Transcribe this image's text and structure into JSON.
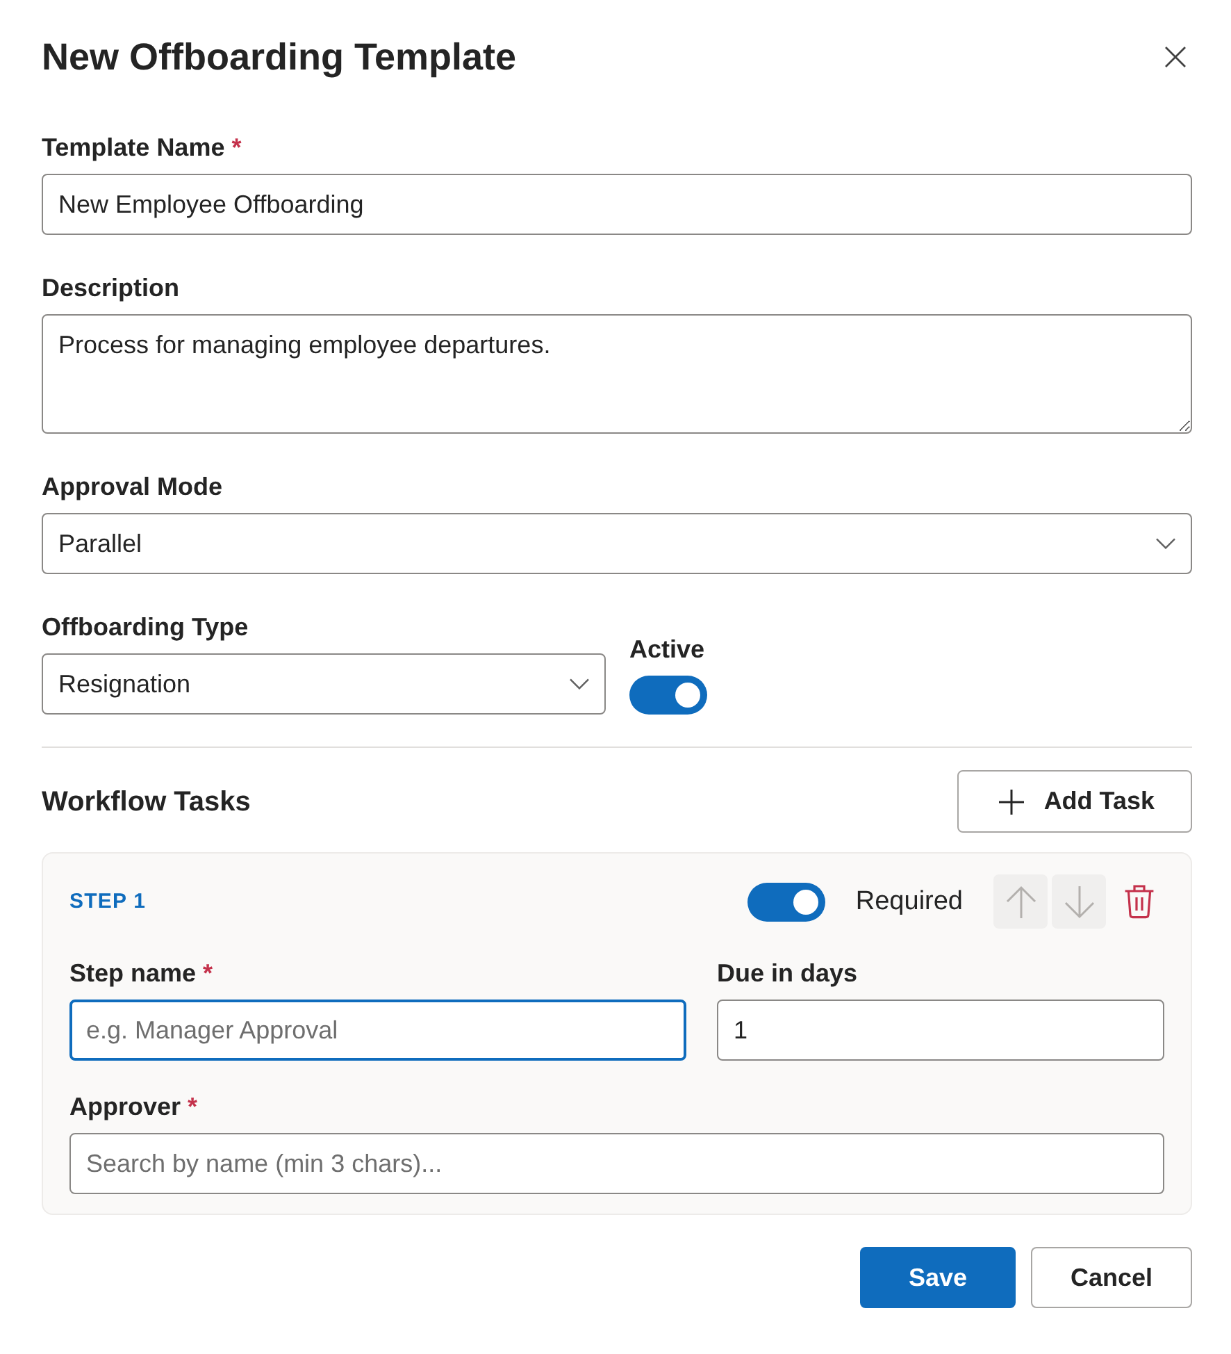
{
  "dialog": {
    "title": "New Offboarding Template"
  },
  "template_name": {
    "label": "Template Name",
    "required_mark": "*",
    "value": "New Employee Offboarding"
  },
  "description": {
    "label": "Description",
    "value": "Process for managing employee departures."
  },
  "approval_mode": {
    "label": "Approval Mode",
    "value": "Parallel"
  },
  "offboarding_type": {
    "label": "Offboarding Type",
    "value": "Resignation"
  },
  "active": {
    "label": "Active",
    "on": true
  },
  "workflow": {
    "title": "Workflow Tasks",
    "add_button": "Add Task",
    "steps": [
      {
        "title": "STEP 1",
        "required": {
          "label": "Required",
          "on": true
        },
        "move_up": {
          "disabled": true
        },
        "move_down": {
          "disabled": true
        },
        "fields": [
          {
            "label": "Step name",
            "required_mark": "*",
            "placeholder": "e.g. Manager Approval",
            "focused": true
          },
          {
            "label": "Due in days",
            "value": "1",
            "focused": false
          },
          {
            "label": "Approver",
            "required_mark": "*",
            "placeholder": "Search by name (min 3 chars)...",
            "focused": false
          }
        ]
      }
    ]
  },
  "buttons": [
    {
      "label": "Save",
      "kind": "primary"
    },
    {
      "label": "Cancel",
      "kind": "secondary"
    }
  ]
}
